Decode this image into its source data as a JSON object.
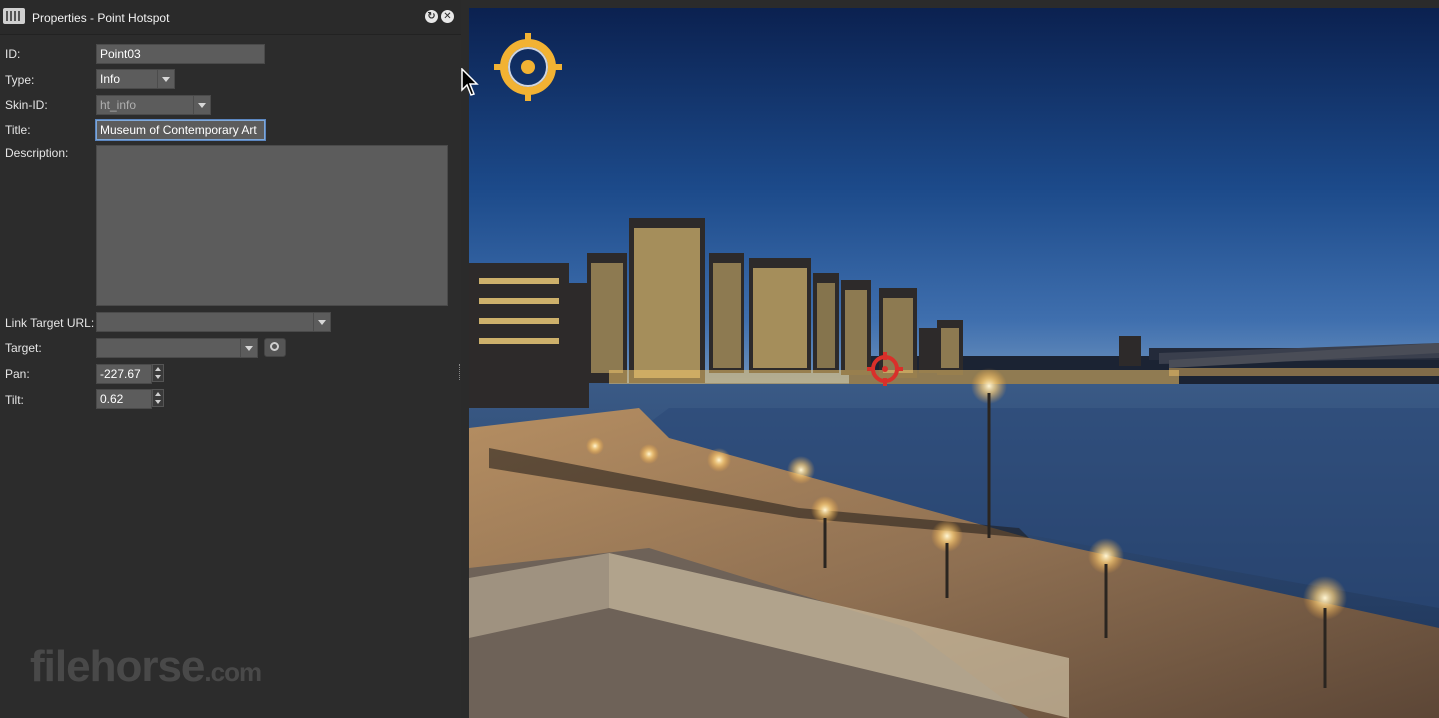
{
  "window": {
    "title": "Properties - Point Hotspot"
  },
  "form": {
    "id_label": "ID:",
    "id_value": "Point03",
    "type_label": "Type:",
    "type_value": "Info",
    "skin_label": "Skin-ID:",
    "skin_value": "ht_info",
    "title_label": "Title:",
    "title_value": "Museum of Contemporary Art",
    "description_label": "Description:",
    "description_value": "",
    "link_label": "Link Target URL:",
    "link_value": "",
    "target_label": "Target:",
    "target_value": "",
    "pan_label": "Pan:",
    "pan_value": "-227.67",
    "tilt_label": "Tilt:",
    "tilt_value": "0.62"
  },
  "watermark": {
    "main": "filehorse",
    "suffix": ".com"
  },
  "colors": {
    "panel_bg": "#2c2c2c",
    "field_bg": "#5c5c5c",
    "focus_border": "#7ea7d8",
    "info_hotspot": "#f2b233",
    "point_hotspot": "#d9302a"
  },
  "icons": {
    "app": "app-icon",
    "refresh": "refresh-icon",
    "close": "close-icon",
    "pick": "pick-target-icon",
    "info_hotspot": "info-hotspot-icon",
    "point_hotspot": "point-hotspot-icon"
  }
}
